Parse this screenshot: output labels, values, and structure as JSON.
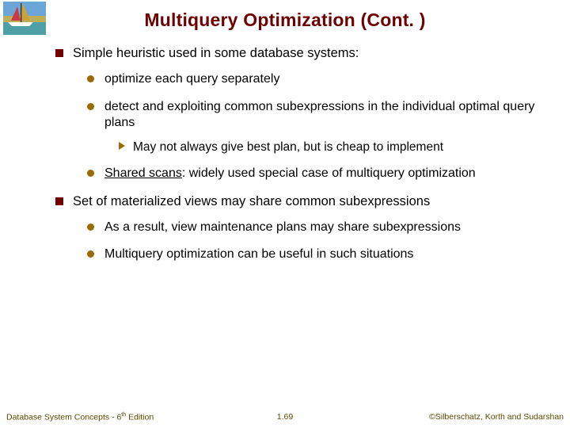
{
  "title": "Multiquery Optimization (Cont. )",
  "bullets": {
    "a": "Simple heuristic used in some database systems:",
    "a1": "optimize each query separately",
    "a2": "detect and exploiting common subexpressions in the individual optimal query plans",
    "a2i": "May not always give best plan, but is cheap to implement",
    "a3_u": "Shared scans",
    "a3_rest": ": widely used special case of multiquery optimization",
    "b": "Set of materialized views may share common subexpressions",
    "b1": "As a result, view maintenance plans may share subexpressions",
    "b2": "Multiquery optimization can be useful in such situations"
  },
  "footer": {
    "left_pre": "Database System Concepts - 6",
    "left_sup": "th",
    "left_post": " Edition",
    "center": "1.69",
    "right": "©Silberschatz, Korth and Sudarshan"
  }
}
